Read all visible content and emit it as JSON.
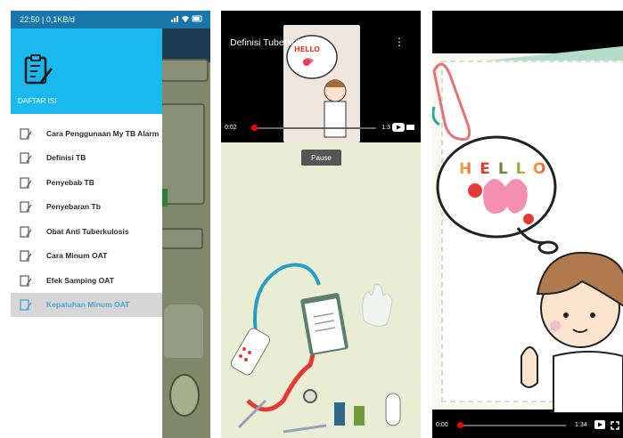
{
  "panel1": {
    "status": {
      "time": "22:50 | 0,1KB/d",
      "icons": "signal wifi battery"
    },
    "drawer": {
      "title": "DAFTAR ISI",
      "items": [
        {
          "label": "Cara Penggunaan My TB Alarm"
        },
        {
          "label": "Definisi TB"
        },
        {
          "label": "Penyebab TB"
        },
        {
          "label": "Penyebaran Tb"
        },
        {
          "label": "Obat Anti Tuberkulosis"
        },
        {
          "label": "Cara Minum OAT"
        },
        {
          "label": "Efek Samping OAT"
        },
        {
          "label": "Kepatuhan Minum OAT",
          "active": true
        }
      ]
    }
  },
  "panel2": {
    "video_title": "Definisi Tuberkulosis",
    "current_time": "0:02",
    "duration": "1:3",
    "pause_label": "Pause",
    "thumb_hello": "HELLO",
    "progress": 0.0
  },
  "panel3": {
    "hello_text": "HELLO",
    "current_time": "0:00",
    "duration": "1:34",
    "progress": 0.0
  },
  "colors": {
    "drawer_header": "#19b9ef",
    "status_bar": "#1976a8",
    "active_item_text": "#4aa6d8",
    "progress": "#ff0000"
  }
}
